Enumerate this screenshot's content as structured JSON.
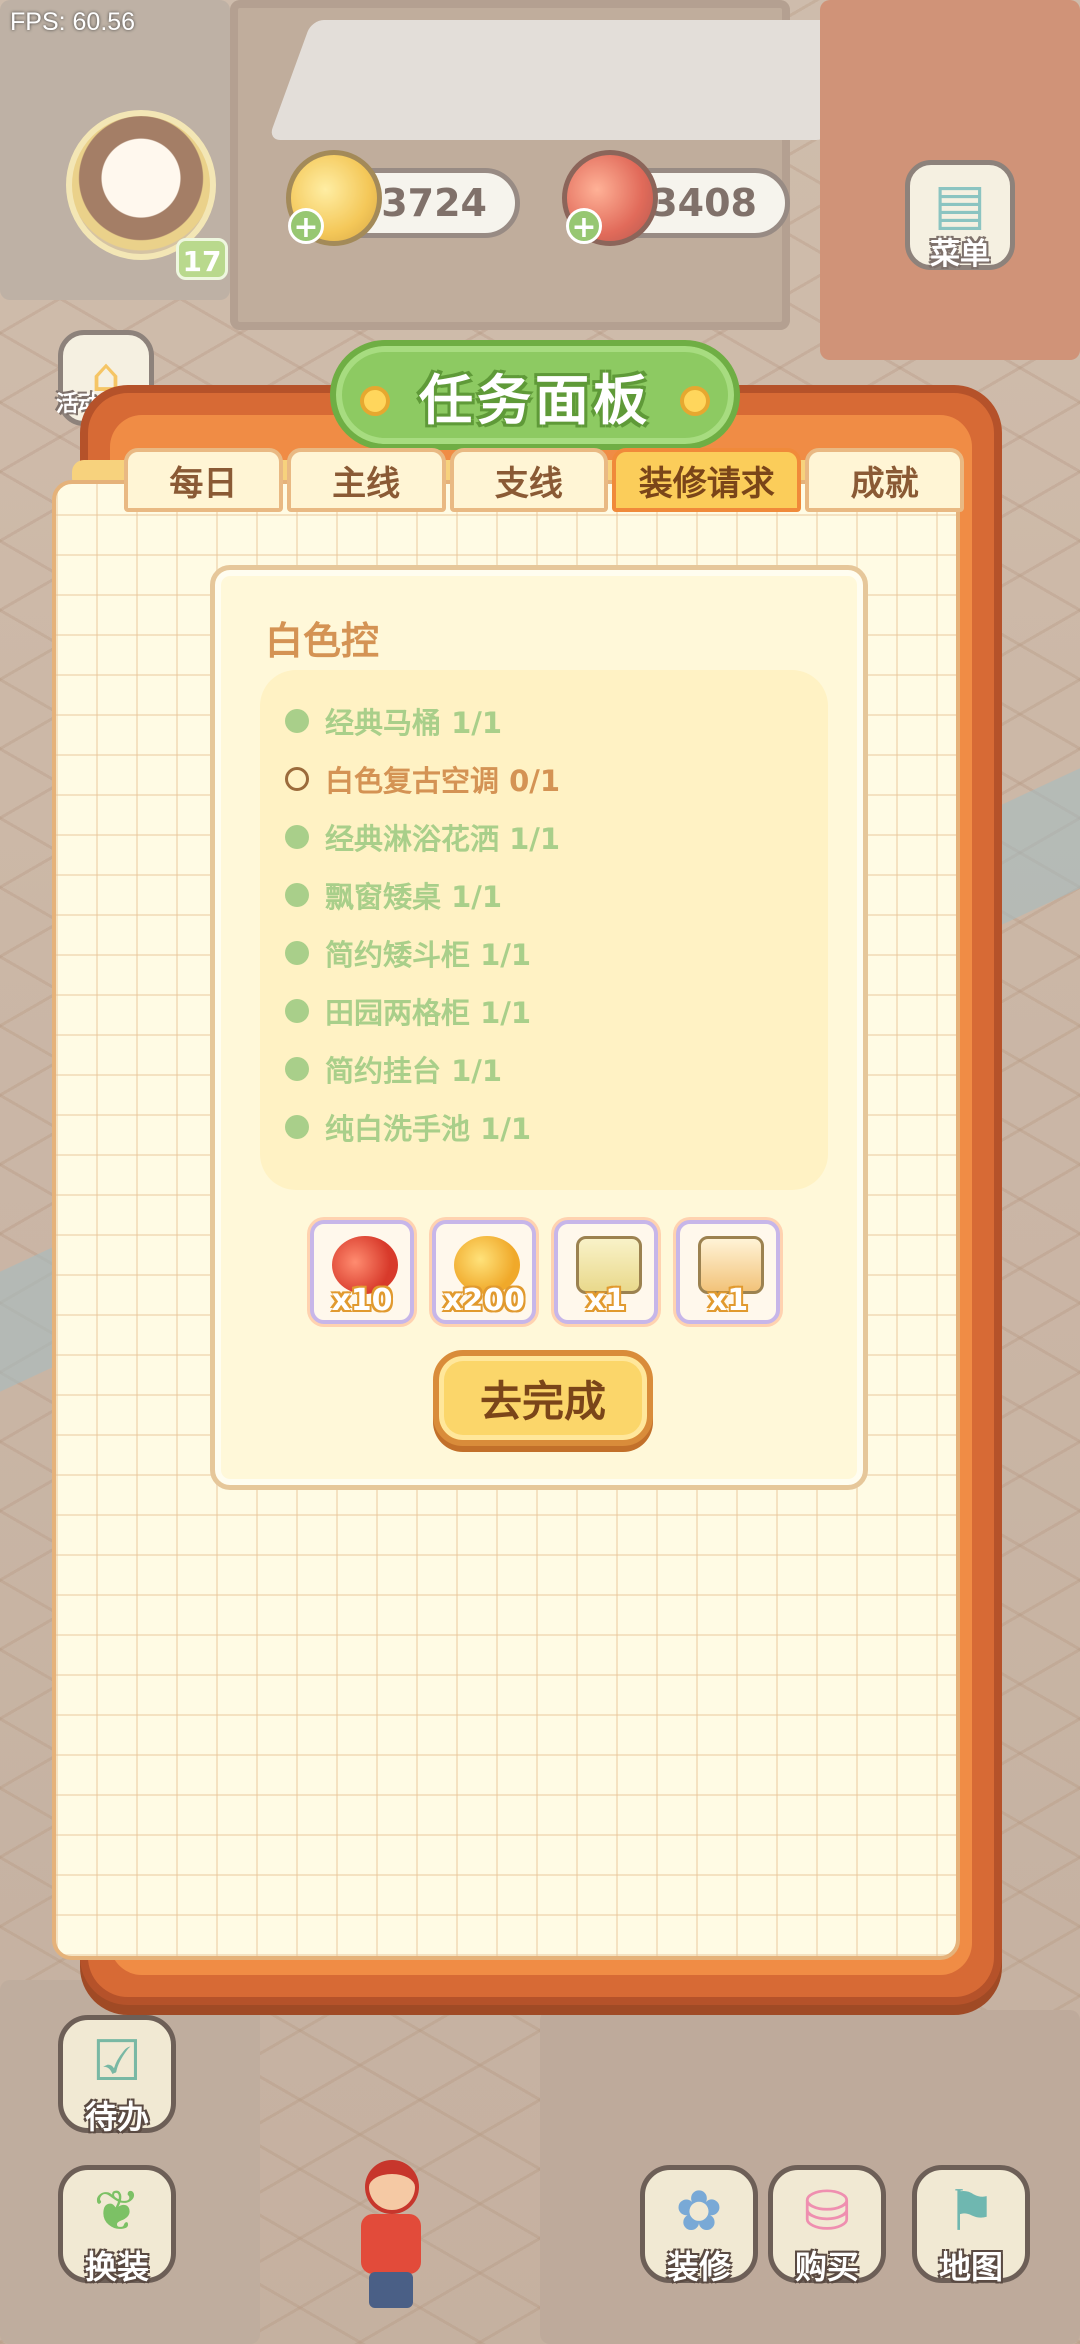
{
  "hud": {
    "fps": "FPS: 60.56",
    "level": "17",
    "coins": "3724",
    "tomatoes": "3408",
    "menu_label": "菜单",
    "activity_label": "活动"
  },
  "panel": {
    "title": "任务面板",
    "tabs": [
      {
        "label": "每日",
        "active": false
      },
      {
        "label": "主线",
        "active": false
      },
      {
        "label": "支线",
        "active": false
      },
      {
        "label": "装修请求",
        "active": true
      },
      {
        "label": "成就",
        "active": false
      }
    ],
    "task": {
      "title": "白色控",
      "requirements": [
        {
          "text": "经典马桶 1/1",
          "done": true
        },
        {
          "text": "白色复古空调 0/1",
          "done": false
        },
        {
          "text": "经典淋浴花洒 1/1",
          "done": true
        },
        {
          "text": "飘窗矮桌 1/1",
          "done": true
        },
        {
          "text": "简约矮斗柜 1/1",
          "done": true
        },
        {
          "text": "田园两格柜 1/1",
          "done": true
        },
        {
          "text": "简约挂台 1/1",
          "done": true
        },
        {
          "text": "纯白洗手池 1/1",
          "done": true
        }
      ],
      "rewards": [
        {
          "icon": "tomatoes-icon",
          "qty": "x10"
        },
        {
          "icon": "coins-icon",
          "qty": "x200"
        },
        {
          "icon": "sprout-box-icon",
          "qty": "x1"
        },
        {
          "icon": "decor-box-icon",
          "qty": "x1"
        }
      ],
      "go_button": "去完成"
    }
  },
  "bottom": {
    "todo": "待办",
    "dress": "换装",
    "decorate": "装修",
    "buy": "购买",
    "map": "地图"
  },
  "colors": {
    "panel_orange": "#d76a35",
    "title_green": "#8dca62",
    "done_green": "#a9cf8a",
    "pending_brown": "#d49354",
    "active_tab": "#fbcd5a"
  }
}
